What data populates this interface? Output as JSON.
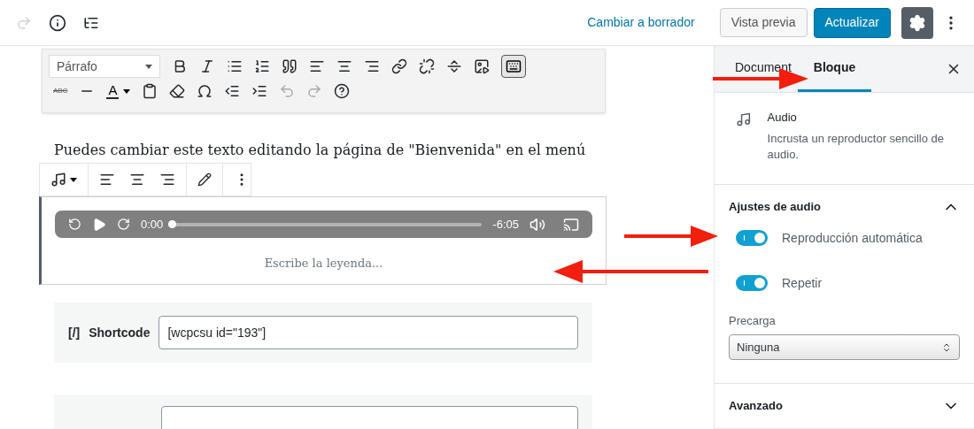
{
  "header": {
    "draft_link": "Cambiar a borrador",
    "preview_button": "Vista previa",
    "update_button": "Actualizar",
    "settings_active": true
  },
  "classic_toolbar": {
    "format_select": "Párrafo",
    "strike_label": "ABC",
    "text_color_label": "A",
    "toolbar_toggle_active": true
  },
  "paragraph": "Puedes cambiar este texto editando la página de \"Bienvenida\" en el menú",
  "audio_block": {
    "player": {
      "current_time": "0:00",
      "remaining_time": "-6:05",
      "level": 0
    },
    "caption_placeholder": "Escribe la leyenda..."
  },
  "shortcode_block": {
    "icon_label": "[/]",
    "label": "Shortcode",
    "value": "[wcpcsu id=\"193\"]"
  },
  "sidebar": {
    "tabs": [
      {
        "label": "Document",
        "selected": false
      },
      {
        "label": "Bloque",
        "selected": true
      }
    ],
    "block_card": {
      "title": "Audio",
      "description": "Incrusta un reproductor sencillo de audio."
    },
    "panels": [
      {
        "title": "Ajustes de audio",
        "expanded": true,
        "toggles": [
          {
            "label": "Reproducción automática",
            "on": true
          },
          {
            "label": "Repetir",
            "on": true
          }
        ],
        "select": {
          "label": "Precarga",
          "value": "Ninguna"
        }
      },
      {
        "title": "Avanzado",
        "expanded": false
      }
    ]
  }
}
